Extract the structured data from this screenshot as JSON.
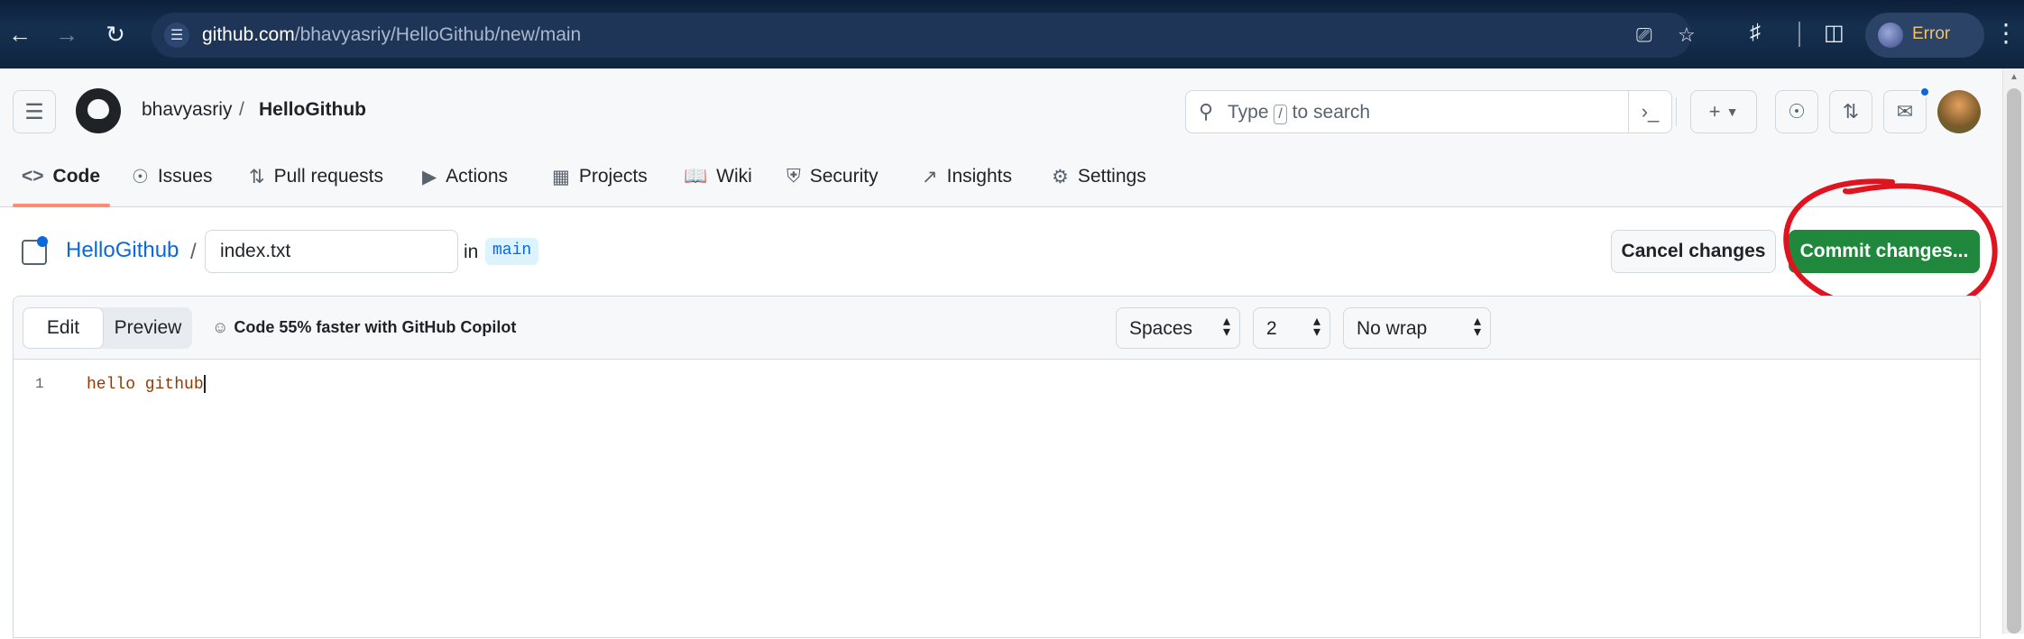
{
  "browser": {
    "url_host": "github.com",
    "url_path": "/bhavyasriy/HelloGithub/new/main",
    "profile_status": "Error"
  },
  "header": {
    "owner": "bhavyasriy",
    "separator": "/",
    "repo": "HelloGithub",
    "search": {
      "prefix": "Type",
      "key": "/",
      "suffix": "to search"
    }
  },
  "tabs": [
    {
      "label": "Code",
      "icon": "code-icon",
      "selected": true
    },
    {
      "label": "Issues",
      "icon": "issue-opened-icon"
    },
    {
      "label": "Pull requests",
      "icon": "git-pull-request-icon"
    },
    {
      "label": "Actions",
      "icon": "play-icon"
    },
    {
      "label": "Projects",
      "icon": "table-icon"
    },
    {
      "label": "Wiki",
      "icon": "book-icon"
    },
    {
      "label": "Security",
      "icon": "shield-icon"
    },
    {
      "label": "Insights",
      "icon": "graph-icon"
    },
    {
      "label": "Settings",
      "icon": "gear-icon"
    }
  ],
  "file": {
    "repo_link": "HelloGithub",
    "separator": "/",
    "filename_value": "index.txt",
    "in_label": "in",
    "branch": "main"
  },
  "actions": {
    "cancel": "Cancel changes",
    "commit": "Commit changes..."
  },
  "editor": {
    "edit_tab": "Edit",
    "preview_tab": "Preview",
    "copilot_text": "Code 55% faster with GitHub Copilot",
    "indent_mode": "Spaces",
    "indent_size": "2",
    "wrap_mode": "No wrap",
    "lines": [
      {
        "number": "1",
        "text": "hello github"
      }
    ]
  },
  "colors": {
    "accent_blue": "#0969da",
    "commit_green": "#1f883d",
    "tab_underline": "#fd8c73",
    "annotation_red": "#e0131f"
  }
}
